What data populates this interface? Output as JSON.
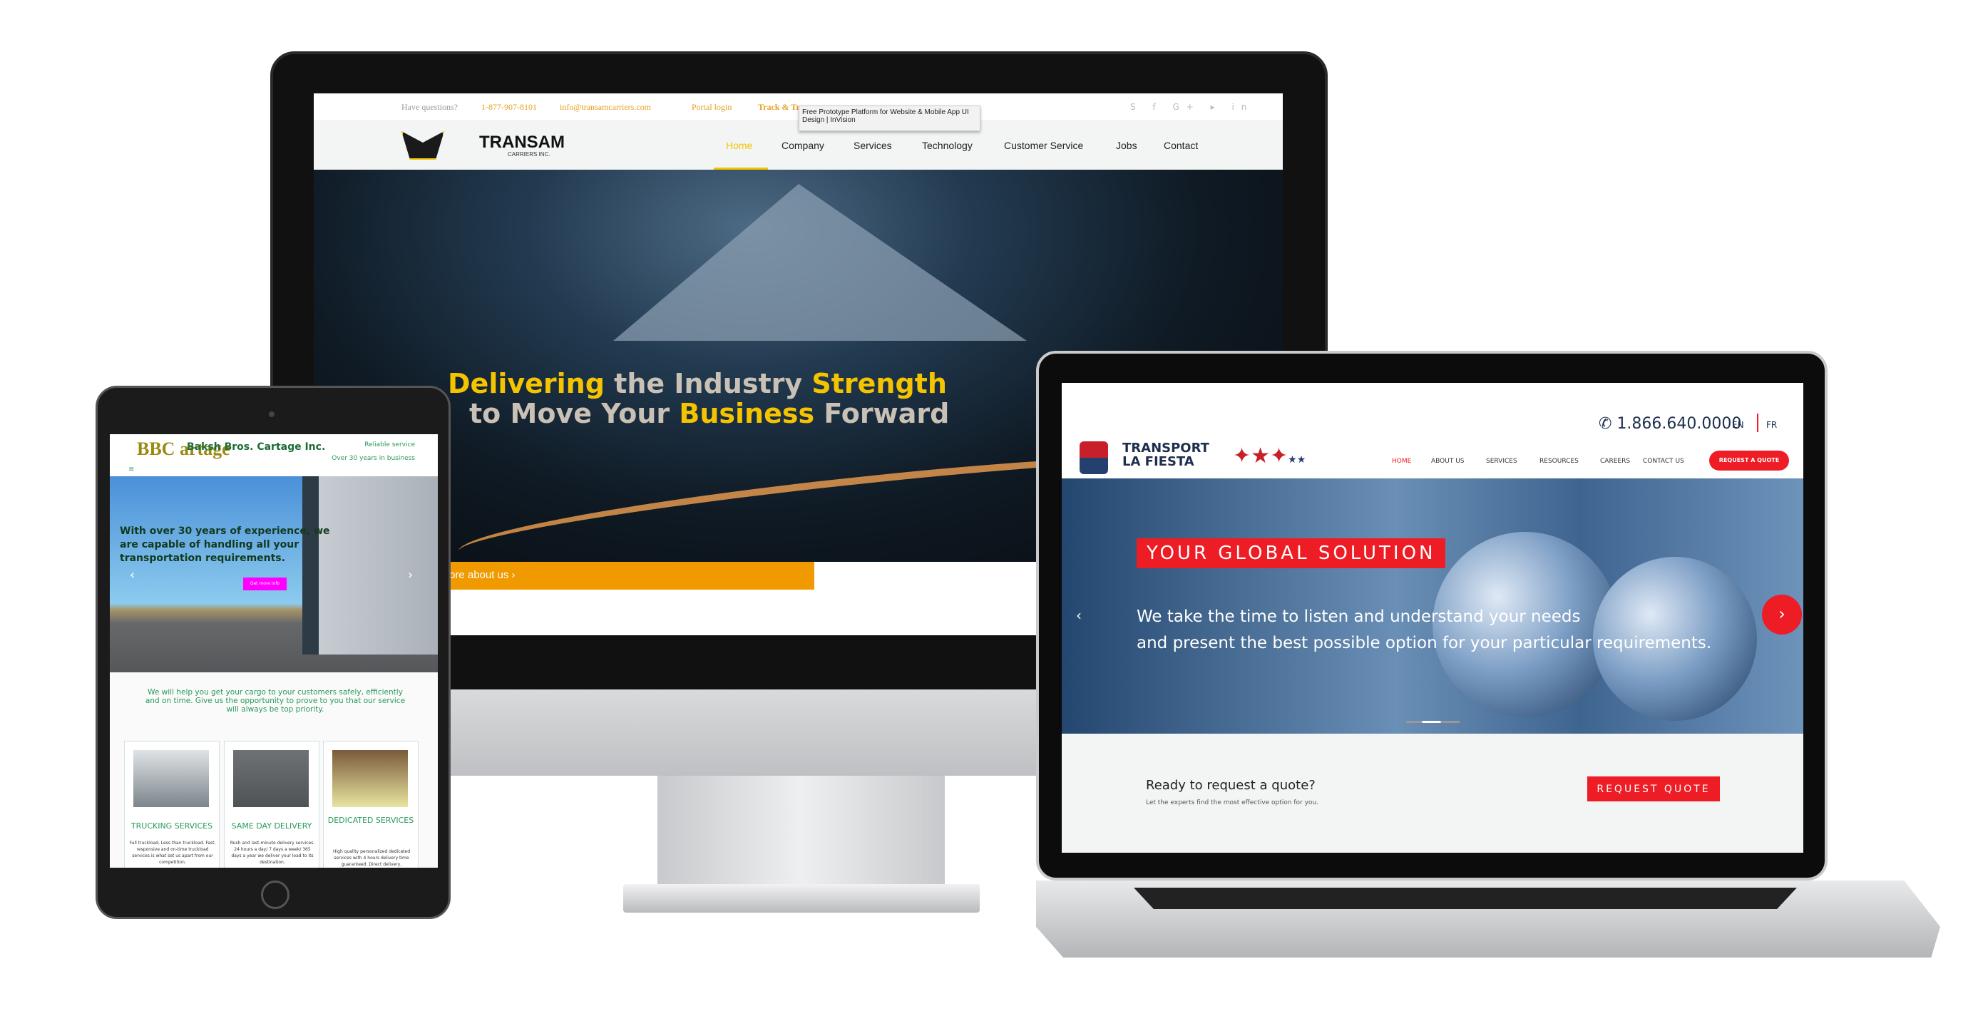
{
  "monitor": {
    "topbar": {
      "question": "Have questions?",
      "phone": "1-877-907-8101",
      "email": "info@transamcarriers.com",
      "portal": "Portal login",
      "track": "Track & Trace",
      "tooltip": "Free Prototype Platform for Website & Mobile App UI Design | InVision",
      "social_icons": [
        "skype-icon",
        "facebook-icon",
        "google-plus-icon",
        "youtube-icon",
        "linkedin-icon"
      ]
    },
    "logo": {
      "name": "TRANSAM",
      "sub": "CARRIERS INC."
    },
    "nav": [
      "Home",
      "Company",
      "Services",
      "Technology",
      "Customer Service",
      "Jobs",
      "Contact"
    ],
    "hero": {
      "l1a": "Delivering",
      "l1b": " the Industry ",
      "l1c": "Strength",
      "l2a": "to Move Your ",
      "l2b": "Business",
      "l2c": " Forward",
      "cta": "ore about us  ›"
    },
    "colors": {
      "accent": "#f5c400",
      "orange": "#f09a00"
    }
  },
  "tablet": {
    "brand": "Baksh Bros. Cartage Inc.",
    "logo": "BBC artage",
    "tag1": "Reliable service",
    "tag2": "Over 30 years in business",
    "hero": "With over 30 years of experience, we are capable of handling all your transportation requirements.",
    "hero_button": "Get more info",
    "intro": "We will help you get your cargo to your customers safely, efficiently and on time. Give us the opportunity to prove to you that our service will always be top priority.",
    "cards": [
      {
        "title": "TRUCKING SERVICES",
        "desc": "Full truckload, Less than truckload. Fast, responsive and on-time truckload services is what set us apart from our competition."
      },
      {
        "title": "SAME DAY DELIVERY",
        "desc": "Rush and last-minute delivery services. 24 hours a day/ 7 days a week/ 365 days a year we deliver your load to its destination."
      },
      {
        "title": "DEDICATED SERVICES",
        "desc": "High quality personalized dedicated services with 4 hours delivery time guaranteed. Direct delivery, appointments"
      }
    ]
  },
  "laptop": {
    "phone": "1.866.640.0000",
    "lang": [
      "EN",
      "FR"
    ],
    "logo": "TRANSPORT LA FIESTA",
    "nav": [
      "HOME",
      "ABOUT US",
      "SERVICES",
      "RESOURCES",
      "CAREERS",
      "CONTACT US"
    ],
    "cta": "REQUEST A QUOTE",
    "hero": {
      "title": "YOUR GLOBAL SOLUTION",
      "l1": "We take the time to listen and understand your needs",
      "l2": "and present the best possible option for your particular requirements."
    },
    "quote": {
      "title": "Ready to request a quote?",
      "sub": "Let the experts find the most effective option for you.",
      "button": "REQUEST QUOTE"
    },
    "colors": {
      "accent": "#ee1c24"
    }
  }
}
